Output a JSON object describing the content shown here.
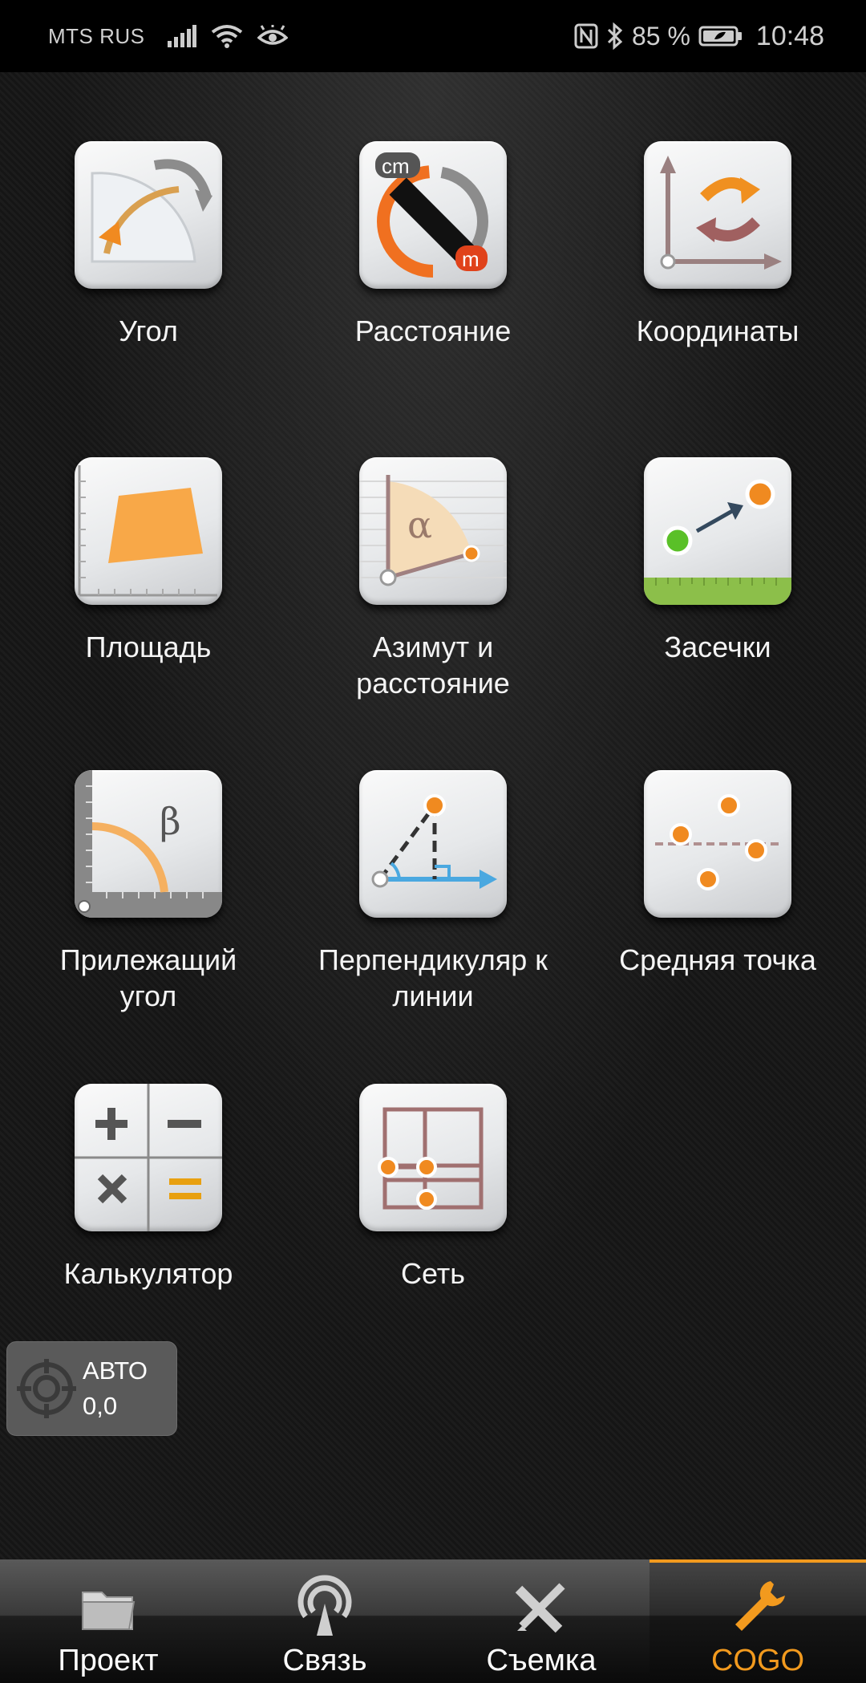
{
  "status_bar": {
    "carrier": "MTS RUS",
    "battery": "85 %",
    "time": "10:48"
  },
  "tiles": [
    {
      "label": "Угол",
      "icon": "angle-icon"
    },
    {
      "label": "Расстояние",
      "icon": "distance-icon"
    },
    {
      "label": "Координаты",
      "icon": "coordinates-icon"
    },
    {
      "label": "Площадь",
      "icon": "area-icon"
    },
    {
      "label": "Азимут и\nрасстояние",
      "icon": "azimuth-distance-icon"
    },
    {
      "label": "Засечки",
      "icon": "intersections-icon"
    },
    {
      "label": "Прилежащий\nугол",
      "icon": "adjacent-angle-icon"
    },
    {
      "label": "Перпендикуляр к\nлинии",
      "icon": "perpendicular-icon"
    },
    {
      "label": "Средняя точка",
      "icon": "midpoint-icon"
    },
    {
      "label": "Калькулятор",
      "icon": "calculator-icon"
    },
    {
      "label": "Сеть",
      "icon": "grid-network-icon"
    }
  ],
  "auto_badge": {
    "mode": "АВТО",
    "value": "0,0"
  },
  "bottom_nav": [
    {
      "label": "Проект",
      "icon": "folder-icon",
      "active": false
    },
    {
      "label": "Связь",
      "icon": "connection-icon",
      "active": false
    },
    {
      "label": "Съемка",
      "icon": "survey-tools-icon",
      "active": false
    },
    {
      "label": "COGO",
      "icon": "wrench-icon",
      "active": true
    }
  ],
  "colors": {
    "accent": "#f29a1e",
    "background": "#0c0c0c",
    "badge": "#5a5a5a"
  }
}
